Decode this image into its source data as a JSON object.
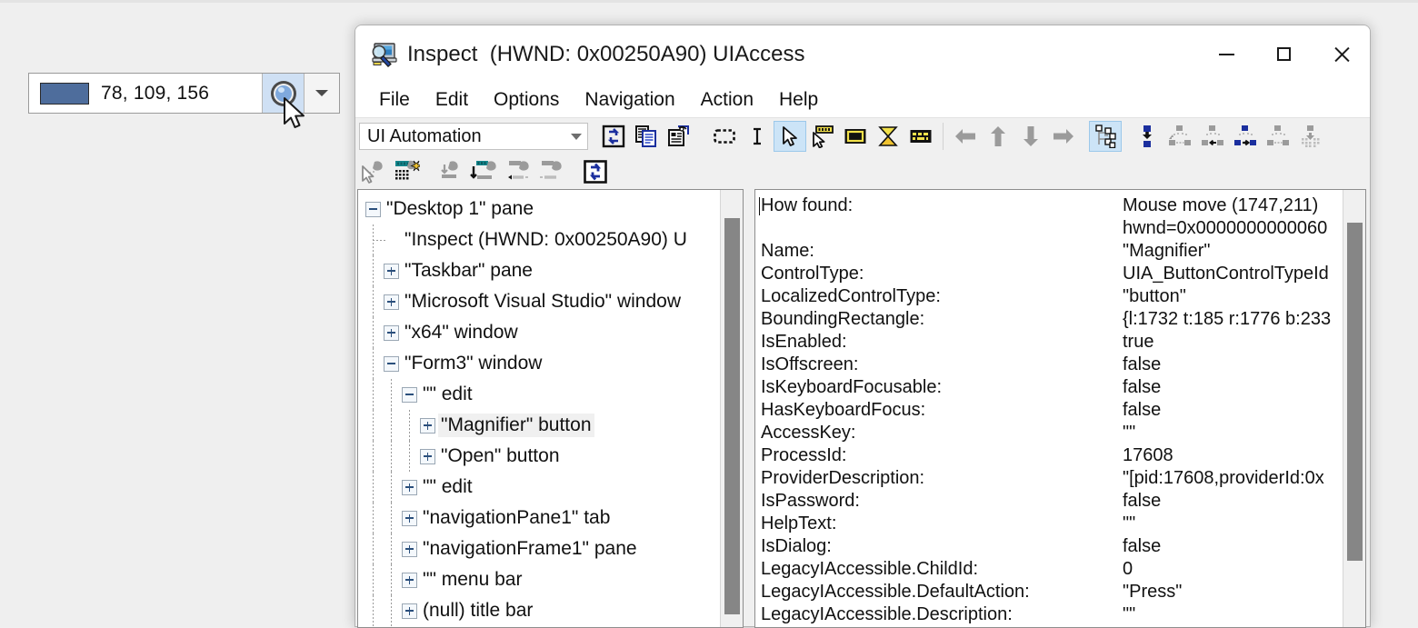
{
  "colorpicker": {
    "swatch_color": "#4e6d9c",
    "value": "78, 109, 156",
    "magnifier_icon": "magnifier-icon",
    "dropdown_icon": "chevron-down-icon"
  },
  "window": {
    "title": "Inspect  (HWND: 0x00250A90) UIAccess",
    "app_icon": "inspect-app-icon",
    "controls": {
      "minimize": "minimize-icon",
      "maximize": "maximize-icon",
      "close": "close-icon"
    }
  },
  "menu": {
    "items": [
      {
        "label": "File"
      },
      {
        "label": "Edit"
      },
      {
        "label": "Options"
      },
      {
        "label": "Navigation"
      },
      {
        "label": "Action"
      },
      {
        "label": "Help"
      }
    ]
  },
  "toolbar": {
    "provider_combo": {
      "value": "UI Automation",
      "caret_icon": "chevron-down-icon"
    },
    "row1": [
      {
        "name": "refresh-icon",
        "selected": false
      },
      {
        "name": "copy-icon",
        "selected": false
      },
      {
        "name": "copy-properties-icon",
        "selected": false
      },
      {
        "name": "rectangle-highlight-icon",
        "selected": false
      },
      {
        "name": "caret-icon",
        "selected": false
      },
      {
        "name": "select-cursor-icon",
        "selected": true
      },
      {
        "name": "watch-cursor-icon",
        "selected": false
      },
      {
        "name": "highlight-rectangle-icon",
        "selected": false
      },
      {
        "name": "watch-focus-icon",
        "selected": false
      },
      {
        "name": "show-ui-icon",
        "selected": false
      },
      {
        "name": "navigate-left-icon",
        "selected": false
      },
      {
        "name": "navigate-up-icon",
        "selected": false
      },
      {
        "name": "navigate-down-icon",
        "selected": false
      },
      {
        "name": "navigate-right-icon",
        "selected": false
      },
      {
        "name": "tree-view-icon",
        "selected": true
      },
      {
        "name": "parent-navigation-icon",
        "selected": false
      },
      {
        "name": "first-child-icon",
        "selected": false
      },
      {
        "name": "previous-sibling-icon",
        "selected": false
      },
      {
        "name": "next-sibling-icon",
        "selected": false
      },
      {
        "name": "last-child-icon",
        "selected": false
      },
      {
        "name": "descendants-icon",
        "selected": false
      }
    ],
    "row2": [
      {
        "name": "pointer-element-icon",
        "selected": false
      },
      {
        "name": "focus-element-icon",
        "selected": false
      },
      {
        "name": "element-from-point-icon",
        "selected": false
      },
      {
        "name": "element-tree-icon",
        "selected": false
      },
      {
        "name": "element-previous-icon",
        "selected": false
      },
      {
        "name": "element-next-icon",
        "selected": false
      },
      {
        "name": "refresh-properties-icon",
        "selected": false
      }
    ]
  },
  "tree": {
    "items": [
      {
        "indent": 0,
        "toggle": "minus",
        "label": "\"Desktop 1\" pane"
      },
      {
        "indent": 1,
        "toggle": "none",
        "label": "\"Inspect  (HWND: 0x00250A90) U"
      },
      {
        "indent": 1,
        "toggle": "plus",
        "label": "\"Taskbar\" pane"
      },
      {
        "indent": 1,
        "toggle": "plus",
        "label": "\"Microsoft Visual Studio\" window"
      },
      {
        "indent": 1,
        "toggle": "plus",
        "label": "\"x64\" window"
      },
      {
        "indent": 1,
        "toggle": "minus",
        "label": "\"Form3\" window"
      },
      {
        "indent": 2,
        "toggle": "minus",
        "label": "\"\" edit"
      },
      {
        "indent": 3,
        "toggle": "plus",
        "label": "\"Magnifier\" button",
        "selected": true
      },
      {
        "indent": 3,
        "toggle": "plus",
        "label": "\"Open\" button"
      },
      {
        "indent": 2,
        "toggle": "plus",
        "label": "\"\" edit"
      },
      {
        "indent": 2,
        "toggle": "plus",
        "label": "\"navigationPane1\" tab"
      },
      {
        "indent": 2,
        "toggle": "plus",
        "label": "\"navigationFrame1\" pane"
      },
      {
        "indent": 2,
        "toggle": "plus",
        "label": "\"\" menu bar"
      },
      {
        "indent": 2,
        "toggle": "plus",
        "label": "(null) title bar"
      }
    ]
  },
  "properties": {
    "rows": [
      {
        "key": "How found:",
        "value": "Mouse move (1747,211)"
      },
      {
        "key": "",
        "value": "hwnd=0x0000000000060"
      },
      {
        "key": "Name:",
        "value": "\"Magnifier\""
      },
      {
        "key": "ControlType:",
        "value": "UIA_ButtonControlTypeId"
      },
      {
        "key": "LocalizedControlType:",
        "value": "\"button\""
      },
      {
        "key": "BoundingRectangle:",
        "value": "{l:1732 t:185 r:1776 b:233"
      },
      {
        "key": "IsEnabled:",
        "value": "true"
      },
      {
        "key": "IsOffscreen:",
        "value": "false"
      },
      {
        "key": "IsKeyboardFocusable:",
        "value": "false"
      },
      {
        "key": "HasKeyboardFocus:",
        "value": "false"
      },
      {
        "key": "AccessKey:",
        "value": "\"\""
      },
      {
        "key": "ProcessId:",
        "value": "17608"
      },
      {
        "key": "ProviderDescription:",
        "value": "\"[pid:17608,providerId:0x"
      },
      {
        "key": "IsPassword:",
        "value": "false"
      },
      {
        "key": "HelpText:",
        "value": "\"\""
      },
      {
        "key": "IsDialog:",
        "value": "false"
      },
      {
        "key": "LegacyIAccessible.ChildId:",
        "value": "0"
      },
      {
        "key": "LegacyIAccessible.DefaultAction:",
        "value": "\"Press\""
      },
      {
        "key": "LegacyIAccessible.Description:",
        "value": "\"\""
      }
    ]
  }
}
